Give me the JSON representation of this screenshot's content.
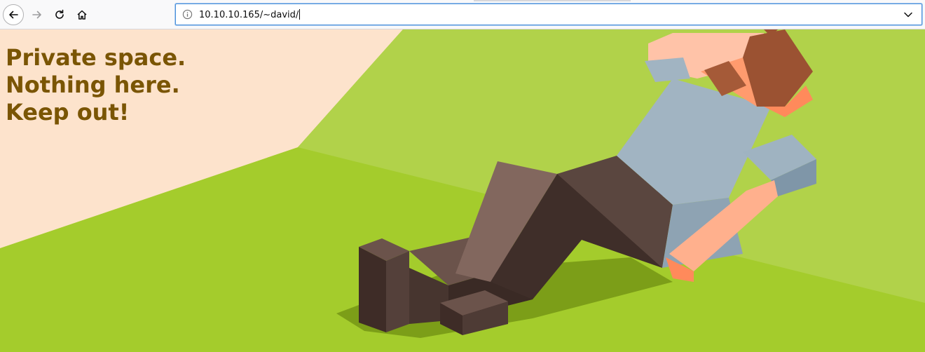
{
  "browser": {
    "url": "10.10.10.165/~david/",
    "back_icon": "arrow-left-icon",
    "forward_icon": "arrow-right-icon",
    "reload_icon": "reload-icon",
    "home_icon": "home-icon",
    "info_icon": "info-icon",
    "dropdown_icon": "chevron-down-icon"
  },
  "page": {
    "heading_lines": [
      "Private space.",
      "Nothing here.",
      "Keep out!"
    ],
    "heading_color": "#7a5504",
    "image": "isometric-man-lying-on-grass"
  }
}
